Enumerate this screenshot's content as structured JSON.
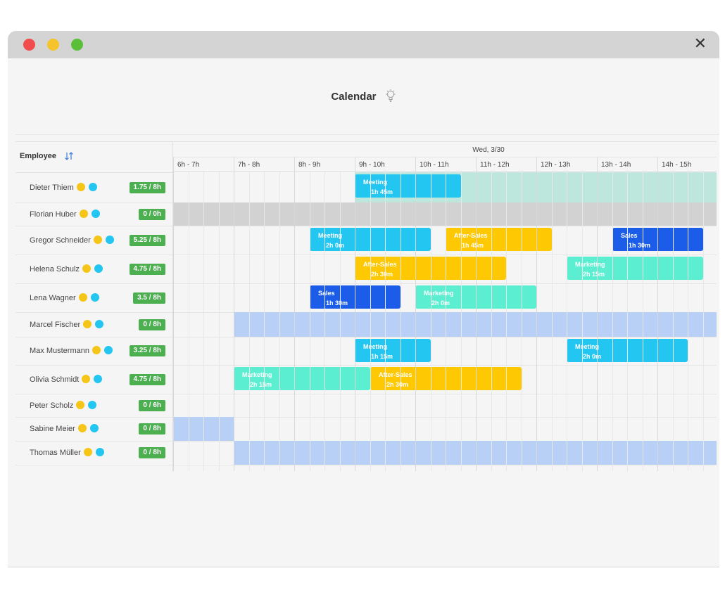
{
  "window": {
    "controls": [
      {
        "name": "close",
        "color": "#f14d4d"
      },
      {
        "name": "minimize",
        "color": "#f5c32c"
      },
      {
        "name": "maximize",
        "color": "#5bbf3a"
      }
    ],
    "close_glyph": "✕"
  },
  "calendar": {
    "title": "Calendar",
    "title_icon": "lightbulb-icon",
    "employee_header": "Employee",
    "sort_icon": "sort-arrows-icon",
    "date": "Wed, 3/30",
    "hours": [
      "6h - 7h",
      "7h - 8h",
      "8h - 9h",
      "9h - 10h",
      "10h - 11h",
      "11h - 12h",
      "12h - 13h",
      "13h - 14h",
      "14h - 15h"
    ]
  },
  "colors": {
    "badge": "#4caf50",
    "dot_yellow": "#f5c518",
    "dot_cyan": "#22c6f0",
    "meeting": "#22c6f0",
    "after_sales": "#fec803",
    "sales": "#1b5de8",
    "marketing": "#5beed0",
    "available": "#b8d0f6",
    "unavailable": "#d2d2d2",
    "present": "#bde6dd"
  },
  "employees": [
    {
      "name": "Dieter Thiem",
      "hours": "1.75 / 8h",
      "band": {
        "start": 9,
        "end": 15,
        "kind": "present"
      },
      "events": [
        {
          "title": "Meeting",
          "duration": "1h 45m",
          "start": 9,
          "end": 10.75,
          "kind": "meeting"
        }
      ]
    },
    {
      "name": "Florian Huber",
      "hours": "0 / 0h",
      "band": {
        "start": 6,
        "end": 15,
        "kind": "unavailable"
      },
      "events": []
    },
    {
      "name": "Gregor Schneider",
      "hours": "5.25 / 8h",
      "band": null,
      "events": [
        {
          "title": "Meeting",
          "duration": "2h 0m",
          "start": 8.25,
          "end": 10.25,
          "kind": "meeting"
        },
        {
          "title": "After-Sales",
          "duration": "1h 45m",
          "start": 10.5,
          "end": 12.25,
          "kind": "after_sales"
        },
        {
          "title": "Sales",
          "duration": "1h 30m",
          "start": 13.25,
          "end": 14.75,
          "kind": "sales"
        }
      ]
    },
    {
      "name": "Helena Schulz",
      "hours": "4.75 / 8h",
      "band": null,
      "events": [
        {
          "title": "After-Sales",
          "duration": "2h 30m",
          "start": 9,
          "end": 11.5,
          "kind": "after_sales"
        },
        {
          "title": "Marketing",
          "duration": "2h 15m",
          "start": 12.5,
          "end": 14.75,
          "kind": "marketing"
        }
      ]
    },
    {
      "name": "Lena Wagner",
      "hours": "3.5 / 8h",
      "band": null,
      "events": [
        {
          "title": "Sales",
          "duration": "1h 30m",
          "start": 8.25,
          "end": 9.75,
          "kind": "sales"
        },
        {
          "title": "Marketing",
          "duration": "2h 0m",
          "start": 10,
          "end": 12,
          "kind": "marketing"
        }
      ]
    },
    {
      "name": "Marcel Fischer",
      "hours": "0 / 8h",
      "band": {
        "start": 7,
        "end": 15,
        "kind": "available"
      },
      "events": []
    },
    {
      "name": "Max Mustermann",
      "hours": "3.25 / 8h",
      "band": null,
      "events": [
        {
          "title": "Meeting",
          "duration": "1h 15m",
          "start": 9,
          "end": 10.25,
          "kind": "meeting"
        },
        {
          "title": "Meeting",
          "duration": "2h 0m",
          "start": 12.5,
          "end": 14.5,
          "kind": "meeting"
        }
      ]
    },
    {
      "name": "Olivia Schmidt",
      "hours": "4.75 / 8h",
      "band": null,
      "events": [
        {
          "title": "Marketing",
          "duration": "2h 15m",
          "start": 7,
          "end": 9.25,
          "kind": "marketing"
        },
        {
          "title": "After-Sales",
          "duration": "2h 30m",
          "start": 9.25,
          "end": 11.75,
          "kind": "after_sales"
        }
      ]
    },
    {
      "name": "Peter Scholz",
      "hours": "0 / 6h",
      "band": null,
      "events": []
    },
    {
      "name": "Sabine Meier",
      "hours": "0 / 8h",
      "band": {
        "start": 6,
        "end": 7,
        "kind": "available"
      },
      "events": []
    },
    {
      "name": "Thomas Müller",
      "hours": "0 / 8h",
      "band": {
        "start": 7,
        "end": 15,
        "kind": "available"
      },
      "events": []
    }
  ]
}
